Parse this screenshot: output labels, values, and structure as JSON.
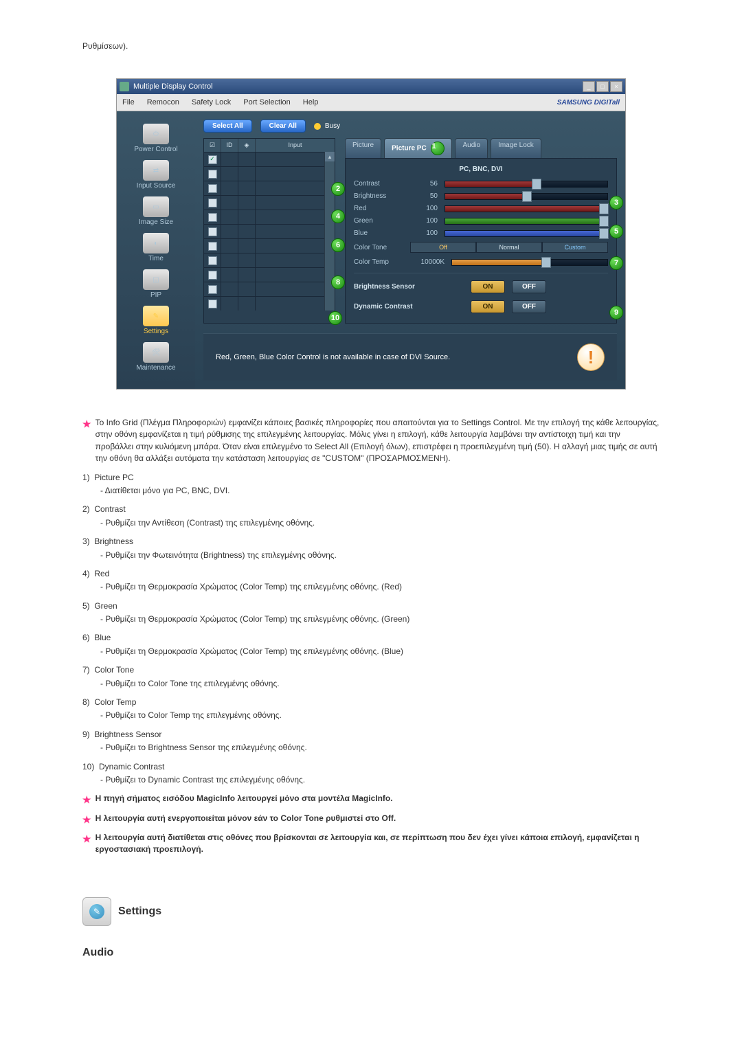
{
  "top_text": "Ρυθμίσεων).",
  "window": {
    "title": "Multiple Display Control",
    "menus": [
      "File",
      "Remocon",
      "Safety Lock",
      "Port Selection",
      "Help"
    ],
    "brand": "SAMSUNG DIGITall"
  },
  "sidebar": {
    "items": [
      {
        "label": "Power Control",
        "icon": "power"
      },
      {
        "label": "Input Source",
        "icon": "input"
      },
      {
        "label": "Image Size",
        "icon": "imagesize"
      },
      {
        "label": "Time",
        "icon": "time"
      },
      {
        "label": "PIP",
        "icon": "pip"
      },
      {
        "label": "Settings",
        "icon": "settings",
        "active": true
      },
      {
        "label": "Maintenance",
        "icon": "maintenance"
      }
    ]
  },
  "controls": {
    "select_all": "Select All",
    "clear_all": "Clear All",
    "busy": "Busy"
  },
  "grid": {
    "headers": {
      "id": "ID",
      "input": "Input"
    },
    "row_count": 11,
    "first_checked": true
  },
  "tabs": [
    {
      "label": "Picture",
      "active": false
    },
    {
      "label": "Picture PC",
      "active": true
    },
    {
      "label": "Audio",
      "active": false
    },
    {
      "label": "Image Lock",
      "active": false
    }
  ],
  "mode_header": "PC, BNC, DVI",
  "sliders": {
    "contrast": {
      "label": "Contrast",
      "value": "56",
      "pct": 56,
      "color": "red"
    },
    "brightness": {
      "label": "Brightness",
      "value": "50",
      "pct": 50,
      "color": "red"
    },
    "red": {
      "label": "Red",
      "value": "100",
      "pct": 100,
      "color": "red"
    },
    "green": {
      "label": "Green",
      "value": "100",
      "pct": 100,
      "color": "green"
    },
    "blue": {
      "label": "Blue",
      "value": "100",
      "pct": 100,
      "color": "blue"
    }
  },
  "color_tone": {
    "label": "Color Tone",
    "opts": [
      "Off",
      "Normal",
      "Custom"
    ]
  },
  "color_temp": {
    "label": "Color Temp",
    "value": "10000K"
  },
  "brightness_sensor": {
    "label": "Brightness Sensor",
    "on": "ON",
    "off": "OFF"
  },
  "dynamic_contrast": {
    "label": "Dynamic Contrast",
    "on": "ON",
    "off": "OFF"
  },
  "note_bar": "Red, Green, Blue Color Control is not available in case of DVI Source.",
  "markers": {
    "1": "1",
    "2": "2",
    "3": "3",
    "4": "4",
    "5": "5",
    "6": "6",
    "7": "7",
    "8": "8",
    "9": "9",
    "10": "10"
  },
  "intro_para": "Το Info Grid (Πλέγμα Πληροφοριών) εμφανίζει κάποιες βασικές πληροφορίες που απαιτούνται για το Settings Control. Με την επιλογή της κάθε λειτουργίας, στην οθόνη εμφανίζεται η τιμή ρύθμισης της επιλεγμένης λειτουργίας. Μόλις γίνει η επιλογή, κάθε λειτουργία λαμβάνει την αντίστοιχη τιμή και την προβάλλει στην κυλιόμενη μπάρα. Όταν είναι επιλεγμένο το Select All (Επιλογή όλων), επιστρέφει η προεπιλεγμένη τιμή (50). Η αλλαγή μιας τιμής σε αυτή την οθόνη θα αλλάξει αυτόματα την κατάσταση λειτουργίας σε \"CUSTOM\" (ΠΡΟΣΑΡΜΟΣΜΕΝΗ).",
  "items": [
    {
      "num": "1)",
      "title": "Picture PC",
      "sub": "- Διατίθεται μόνο για PC, BNC, DVI."
    },
    {
      "num": "2)",
      "title": "Contrast",
      "sub": "- Ρυθμίζει την Αντίθεση (Contrast) της επιλεγμένης οθόνης."
    },
    {
      "num": "3)",
      "title": "Brightness",
      "sub": "- Ρυθμίζει την Φωτεινότητα (Brightness) της επιλεγμένης οθόνης."
    },
    {
      "num": "4)",
      "title": "Red",
      "sub": "- Ρυθμίζει τη Θερμοκρασία Χρώματος (Color Temp) της επιλεγμένης οθόνης. (Red)"
    },
    {
      "num": "5)",
      "title": "Green",
      "sub": "- Ρυθμίζει τη Θερμοκρασία Χρώματος (Color Temp) της επιλεγμένης οθόνης. (Green)"
    },
    {
      "num": "6)",
      "title": "Blue",
      "sub": "- Ρυθμίζει τη Θερμοκρασία Χρώματος (Color Temp) της επιλεγμένης οθόνης. (Blue)"
    },
    {
      "num": "7)",
      "title": "Color Tone",
      "sub": "- Ρυθμίζει το Color Tone της επιλεγμένης οθόνης."
    },
    {
      "num": "8)",
      "title": "Color Temp",
      "sub": "- Ρυθμίζει το Color Temp της επιλεγμένης οθόνης."
    },
    {
      "num": "9)",
      "title": "Brightness Sensor",
      "sub": "- Ρυθμίζει το Brightness Sensor της επιλεγμένης οθόνης."
    },
    {
      "num": "10)",
      "title": "Dynamic Contrast",
      "sub": "- Ρυθμίζει το Dynamic Contrast της επιλεγμένης οθόνης."
    }
  ],
  "bold_notes": [
    "Η πηγή σήματος εισόδου MagicInfo λειτουργεί μόνο στα μοντέλα MagicInfo.",
    "Η λειτουργία αυτή ενεργοποιείται μόνον εάν το Color Tone ρυθμιστεί στο Off.",
    "Η λειτουργία αυτή διατίθεται στις οθόνες που βρίσκονται σε λειτουργία και, σε περίπτωση που δεν έχει γίνει κάποια επιλογή, εμφανίζεται η εργοστασιακή προεπιλογή."
  ],
  "settings_heading": "Settings",
  "audio_heading": "Audio"
}
